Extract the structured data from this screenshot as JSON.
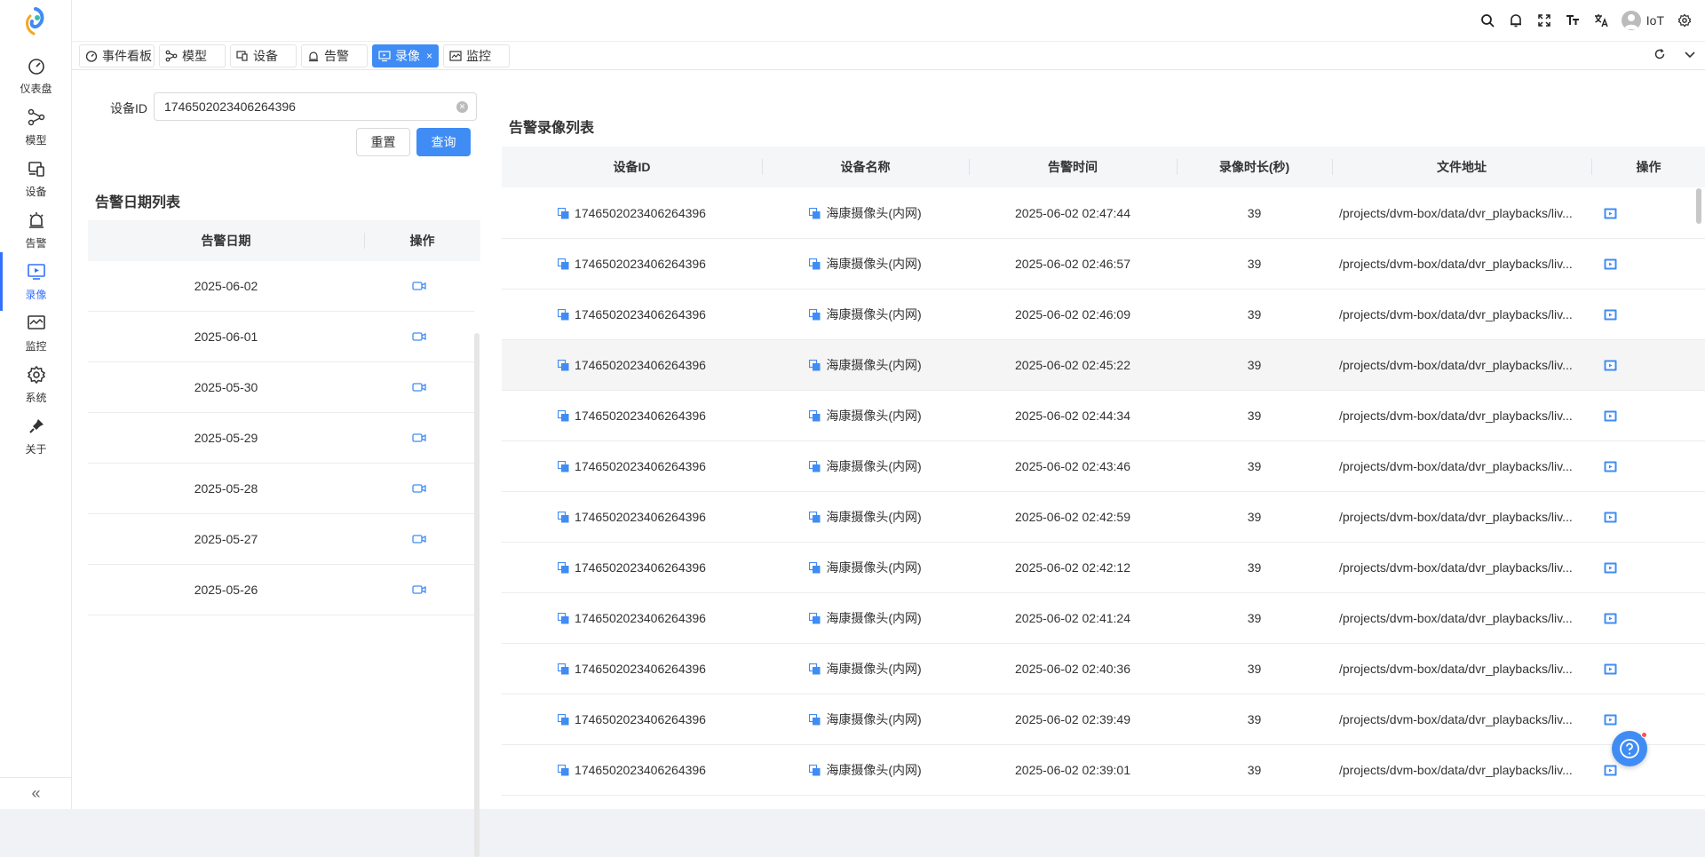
{
  "nav": {
    "items": [
      {
        "label": "仪表盘",
        "icon": "dashboard-icon"
      },
      {
        "label": "模型",
        "icon": "model-icon"
      },
      {
        "label": "设备",
        "icon": "device-icon"
      },
      {
        "label": "告警",
        "icon": "alarm-icon"
      },
      {
        "label": "录像",
        "icon": "recording-icon",
        "active": true
      },
      {
        "label": "监控",
        "icon": "monitor-icon"
      },
      {
        "label": "系统",
        "icon": "gear-icon"
      },
      {
        "label": "关于",
        "icon": "pin-icon"
      }
    ],
    "collapse_label": "«"
  },
  "header": {
    "user_name": "IoT",
    "icons": [
      "search-icon",
      "bell-icon",
      "fullscreen-icon",
      "font-size-icon",
      "translate-icon",
      "avatar",
      "settings-icon"
    ]
  },
  "tabs": [
    {
      "label": "事件看板"
    },
    {
      "label": "模型"
    },
    {
      "label": "设备"
    },
    {
      "label": "告警"
    },
    {
      "label": "录像",
      "active": true,
      "close": "×"
    },
    {
      "label": "监控"
    }
  ],
  "search": {
    "label": "设备ID",
    "value": "1746502023406264396",
    "reset_label": "重置",
    "query_label": "查询"
  },
  "date_list": {
    "title": "告警日期列表",
    "headers": [
      "告警日期",
      "操作"
    ],
    "rows": [
      "2025-06-02",
      "2025-06-01",
      "2025-05-30",
      "2025-05-29",
      "2025-05-28",
      "2025-05-27",
      "2025-05-26"
    ]
  },
  "recording_list": {
    "title": "告警录像列表",
    "headers": [
      "设备ID",
      "设备名称",
      "告警时间",
      "录像时长(秒)",
      "文件地址",
      "操作"
    ],
    "rows": [
      {
        "device_id": "1746502023406264396",
        "device_name": "海康摄像头(内网)",
        "time": "2025-06-02 02:47:44",
        "duration": "39",
        "path": "/projects/dvm-box/data/dvr_playbacks/liv..."
      },
      {
        "device_id": "1746502023406264396",
        "device_name": "海康摄像头(内网)",
        "time": "2025-06-02 02:46:57",
        "duration": "39",
        "path": "/projects/dvm-box/data/dvr_playbacks/liv..."
      },
      {
        "device_id": "1746502023406264396",
        "device_name": "海康摄像头(内网)",
        "time": "2025-06-02 02:46:09",
        "duration": "39",
        "path": "/projects/dvm-box/data/dvr_playbacks/liv..."
      },
      {
        "device_id": "1746502023406264396",
        "device_name": "海康摄像头(内网)",
        "time": "2025-06-02 02:45:22",
        "duration": "39",
        "path": "/projects/dvm-box/data/dvr_playbacks/liv..."
      },
      {
        "device_id": "1746502023406264396",
        "device_name": "海康摄像头(内网)",
        "time": "2025-06-02 02:44:34",
        "duration": "39",
        "path": "/projects/dvm-box/data/dvr_playbacks/liv..."
      },
      {
        "device_id": "1746502023406264396",
        "device_name": "海康摄像头(内网)",
        "time": "2025-06-02 02:43:46",
        "duration": "39",
        "path": "/projects/dvm-box/data/dvr_playbacks/liv..."
      },
      {
        "device_id": "1746502023406264396",
        "device_name": "海康摄像头(内网)",
        "time": "2025-06-02 02:42:59",
        "duration": "39",
        "path": "/projects/dvm-box/data/dvr_playbacks/liv..."
      },
      {
        "device_id": "1746502023406264396",
        "device_name": "海康摄像头(内网)",
        "time": "2025-06-02 02:42:12",
        "duration": "39",
        "path": "/projects/dvm-box/data/dvr_playbacks/liv..."
      },
      {
        "device_id": "1746502023406264396",
        "device_name": "海康摄像头(内网)",
        "time": "2025-06-02 02:41:24",
        "duration": "39",
        "path": "/projects/dvm-box/data/dvr_playbacks/liv..."
      },
      {
        "device_id": "1746502023406264396",
        "device_name": "海康摄像头(内网)",
        "time": "2025-06-02 02:40:36",
        "duration": "39",
        "path": "/projects/dvm-box/data/dvr_playbacks/liv..."
      },
      {
        "device_id": "1746502023406264396",
        "device_name": "海康摄像头(内网)",
        "time": "2025-06-02 02:39:49",
        "duration": "39",
        "path": "/projects/dvm-box/data/dvr_playbacks/liv..."
      },
      {
        "device_id": "1746502023406264396",
        "device_name": "海康摄像头(内网)",
        "time": "2025-06-02 02:39:01",
        "duration": "39",
        "path": "/projects/dvm-box/data/dvr_playbacks/liv..."
      }
    ]
  },
  "colors": {
    "accent": "#3f8cf4",
    "primary": "#3370ff"
  }
}
